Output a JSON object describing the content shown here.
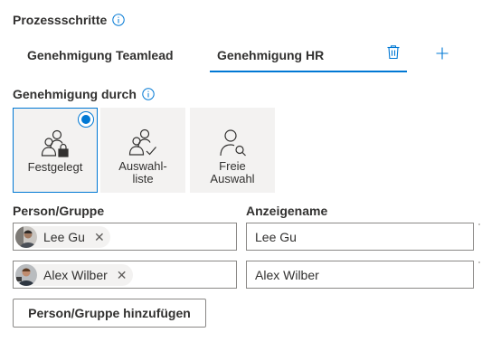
{
  "steps": {
    "label": "Prozessschritte",
    "info_icon": "info-icon",
    "tabs": [
      {
        "label": "Genehmigung Teamlead",
        "selected": false
      },
      {
        "label": "Genehmigung HR",
        "selected": true
      }
    ],
    "delete_icon": "trash-icon",
    "add_icon": "plus-icon"
  },
  "approval": {
    "label": "Genehmigung durch",
    "info_icon": "info-icon",
    "options": [
      {
        "label": "Festgelegt",
        "icon": "people-lock-icon",
        "selected": true
      },
      {
        "label": "Auswahl-\nliste",
        "icon": "people-check-icon",
        "selected": false
      },
      {
        "label": "Freie\nAuswahl",
        "icon": "person-search-icon",
        "selected": false
      }
    ]
  },
  "people": {
    "person_header": "Person/Gruppe",
    "display_header": "Anzeigename",
    "rows": [
      {
        "persona": "Lee Gu",
        "display_name": "Lee Gu"
      },
      {
        "persona": "Alex Wilber",
        "display_name": "Alex Wilber"
      }
    ],
    "remove_symbol": "✕"
  },
  "add_button": "Person/Gruppe hinzufügen",
  "colors": {
    "accent": "#0078d4",
    "tile_bg": "#f3f2f1",
    "border": "#8a8886",
    "text": "#323130"
  }
}
